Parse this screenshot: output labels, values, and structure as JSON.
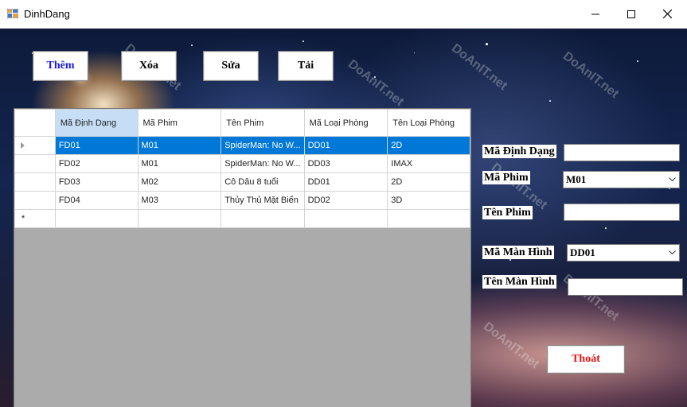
{
  "window": {
    "title": "DinhDang",
    "controls": {
      "minimize": "minimize-icon",
      "maximize": "maximize-icon",
      "close": "close-icon"
    }
  },
  "toolbar": {
    "add_label": "Thêm",
    "delete_label": "Xóa",
    "edit_label": "Sửa",
    "reload_label": "Tải"
  },
  "grid": {
    "columns": [
      "Mã Định Dạng",
      "Mã Phim",
      "Tên Phim",
      "Mã Loại Phòng",
      "Tên Loại Phòng"
    ],
    "rows": [
      [
        "FD01",
        "M01",
        "SpiderMan: No W...",
        "DD01",
        "2D"
      ],
      [
        "FD02",
        "M01",
        "SpiderMan: No W...",
        "DD03",
        "IMAX"
      ],
      [
        "FD03",
        "M02",
        "Cô Dâu 8 tuổi",
        "DD01",
        "2D"
      ],
      [
        "FD04",
        "M03",
        "Thủy Thủ Mặt Biển",
        "DD02",
        "3D"
      ]
    ],
    "new_row_marker": "*"
  },
  "form": {
    "format_code_label": "Mã Định Dạng",
    "format_code_value": "",
    "movie_code_label": "Mã Phim",
    "movie_code_value": "M01",
    "movie_name_label": "Tên Phim",
    "movie_name_value": "",
    "screen_code_label": "Mã Màn Hình",
    "screen_code_value": "DD01",
    "screen_name_label": "Tên Màn Hình",
    "screen_name_value": ""
  },
  "exit_label": "Thoát",
  "watermark": "DoAnIT.net",
  "colors": {
    "selection": "#0078d7",
    "add_text": "#1a1adb",
    "exit_text": "#e01010",
    "header_selected": "#c6def5"
  }
}
